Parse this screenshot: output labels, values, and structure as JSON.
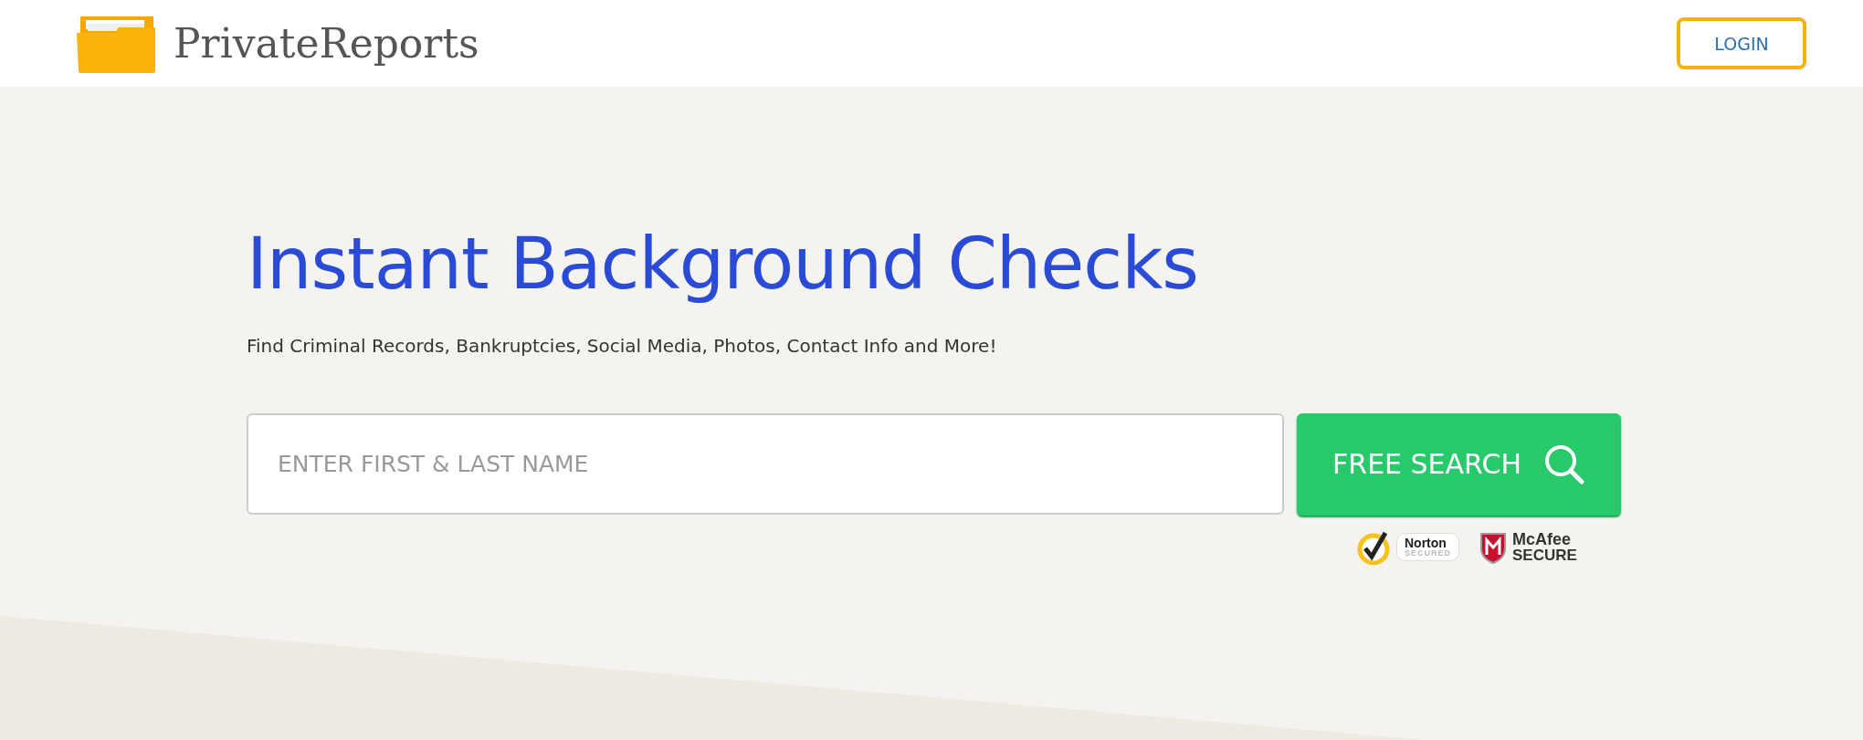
{
  "header": {
    "brand": "PrivateReports",
    "login_button": "LOGIN"
  },
  "hero": {
    "title": "Instant Background Checks",
    "subtitle": "Find Criminal Records, Bankruptcies, Social Media, Photos, Contact Info and More!",
    "search": {
      "placeholder": "ENTER FIRST & LAST NAME",
      "button": "FREE SEARCH"
    },
    "badges": [
      {
        "kind": "norton",
        "name": "Norton",
        "caption": "SECURED"
      },
      {
        "kind": "mcafee",
        "name": "McAfee",
        "caption": "SECURE"
      }
    ]
  }
}
